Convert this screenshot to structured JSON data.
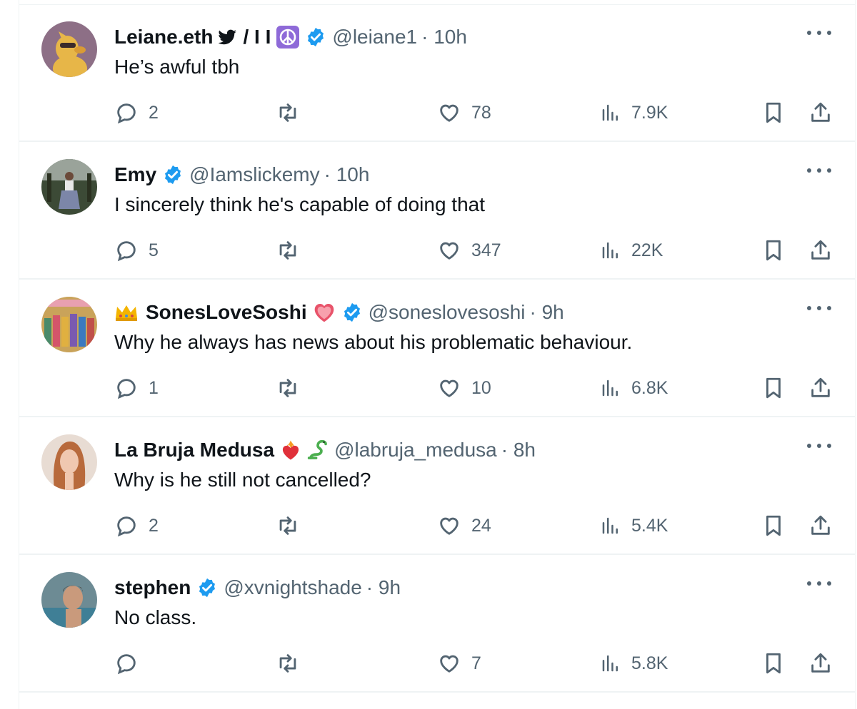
{
  "tweets": [
    {
      "name": "Leiane.eth",
      "name_extra": "/ I I",
      "handle": "@leiane1",
      "time": "· 10h",
      "text": "He’s awful tbh",
      "replies": "2",
      "likes": "78",
      "views": "7.9K",
      "avatar_colors": {
        "bg": "#8d6f86",
        "fg": "#e7b648"
      }
    },
    {
      "name": "Emy",
      "handle": "@Iamslickemy",
      "time": "· 10h",
      "text": "I sincerely think he's capable of doing that",
      "replies": "5",
      "likes": "347",
      "views": "22K",
      "avatar_colors": {
        "bg": "#3c4a36",
        "fg": "#7c86a8"
      }
    },
    {
      "name": "SonesLoveSoshi",
      "handle": "@soneslovesoshi",
      "time": "· 9h",
      "text": "Why he always has news about his problematic behaviour.",
      "replies": "1",
      "likes": "10",
      "views": "6.8K",
      "avatar_colors": {
        "bg": "#c9a35a",
        "fg": "#4a8a6a"
      }
    },
    {
      "name": "La Bruja Medusa",
      "handle": "@labruja_medusa",
      "time": "· 8h",
      "text": "Why is he still not cancelled?",
      "replies": "2",
      "likes": "24",
      "views": "5.4K",
      "avatar_colors": {
        "bg": "#e8dcd3",
        "fg": "#b86a3c"
      }
    },
    {
      "name": "stephen",
      "handle": "@xvnightshade",
      "time": "· 9h",
      "text": "No class.",
      "replies": "",
      "likes": "7",
      "views": "5.8K",
      "avatar_colors": {
        "bg": "#6d8b94",
        "fg": "#c99a7c"
      }
    }
  ],
  "colors": {
    "verified": "#1d9bf0",
    "action_gray": "#536471",
    "divider": "#eff3f4",
    "peace_bg": "#8e6ad8"
  }
}
